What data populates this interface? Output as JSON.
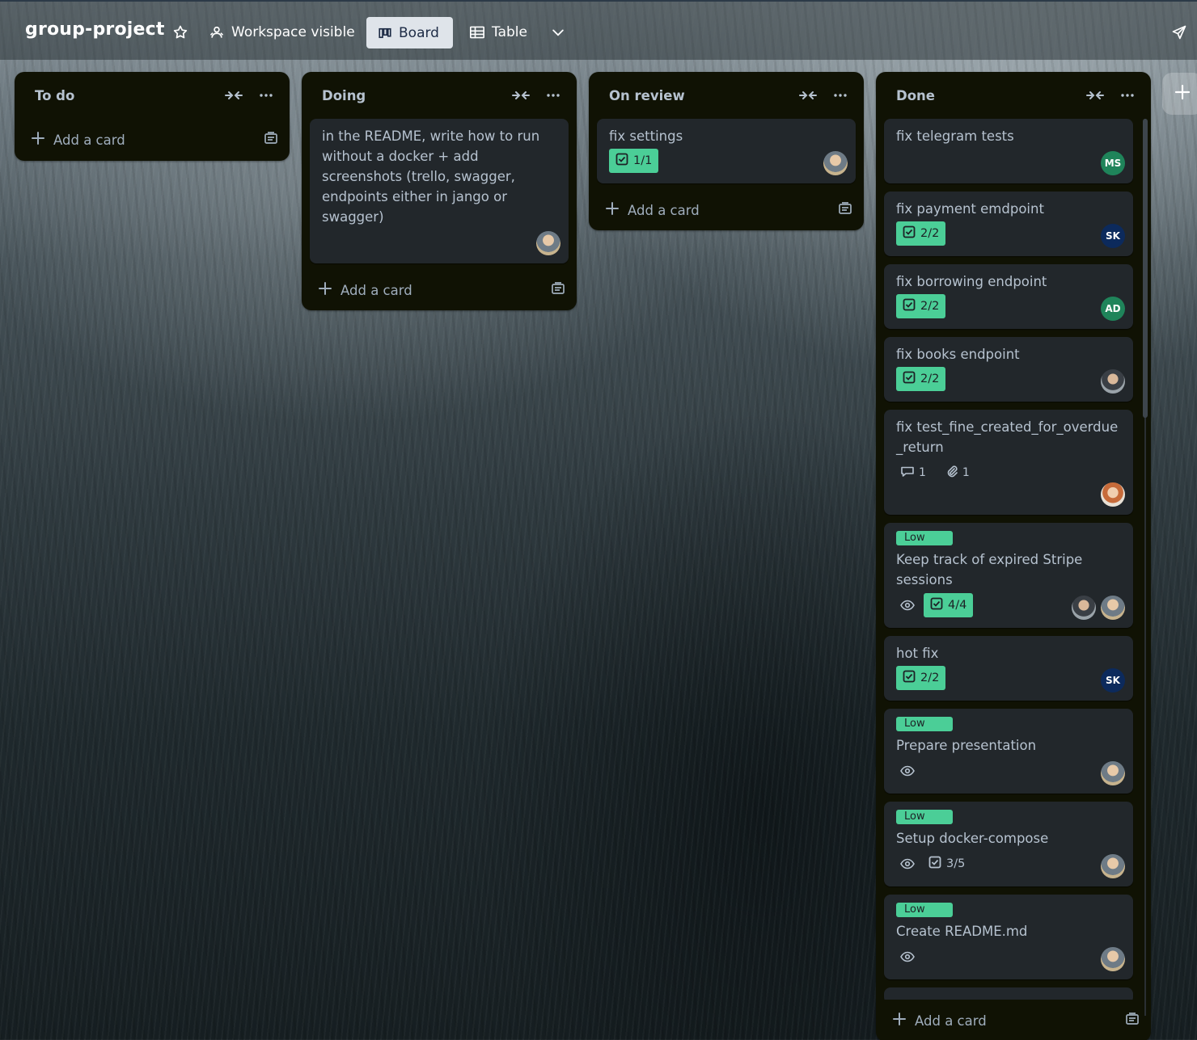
{
  "header": {
    "board_title": "group-project",
    "visibility_label": "Workspace visible",
    "board_view_label": "Board",
    "table_view_label": "Table"
  },
  "icons": {
    "star": "star-icon",
    "visibility": "people-icon",
    "board": "board-icon",
    "table": "table-icon",
    "more_views": "chevron-down-icon",
    "share": "send-icon",
    "collapse": "collapse-icon",
    "list_menu": "ellipsis-icon",
    "add": "plus-icon",
    "template": "template-icon",
    "checklist": "checklist-icon",
    "watch": "eye-icon",
    "comment": "comment-icon",
    "attachment": "paperclip-icon"
  },
  "colors": {
    "list_bg": "#101204",
    "card_bg": "#22272b",
    "label_green": "#4bce97",
    "avatar_ms": "#1f845a",
    "avatar_sk": "#0c2a5c",
    "avatar_ad": "#1f845a"
  },
  "lists": [
    {
      "title": "To do",
      "add_card_label": "Add a card",
      "cards": []
    },
    {
      "title": "Doing",
      "add_card_label": "Add a card",
      "cards": [
        {
          "title": "in the README, write how to run without a docker + add screenshots (trello, swagger, endpoints either in jango or swagger)"
        }
      ]
    },
    {
      "title": "On review",
      "add_card_label": "Add a card",
      "cards": [
        {
          "title": "fix settings",
          "checklist": "1/1"
        }
      ]
    },
    {
      "title": "Done",
      "add_card_label": "Add a card",
      "cards": [
        {
          "title": "fix telegram tests",
          "avatar": "MS"
        },
        {
          "title": "fix payment emdpoint",
          "checklist": "2/2",
          "avatar": "SK"
        },
        {
          "title": "fix borrowing endpoint",
          "checklist": "2/2",
          "avatar": "AD"
        },
        {
          "title": "fix books endpoint",
          "checklist": "2/2"
        },
        {
          "title": "fix test_fine_created_for_overdue_return",
          "comments": "1",
          "attachments": "1"
        },
        {
          "label": "Low",
          "title": "Keep track of expired Stripe sessions",
          "checklist": "4/4"
        },
        {
          "title": "hot fix",
          "checklist": "2/2",
          "avatar": "SK"
        },
        {
          "label": "Low",
          "title": "Prepare presentation"
        },
        {
          "label": "Low",
          "title": "Setup docker-compose",
          "checklist": "3/5"
        },
        {
          "label": "Low",
          "title": "Create README.md"
        }
      ]
    }
  ]
}
